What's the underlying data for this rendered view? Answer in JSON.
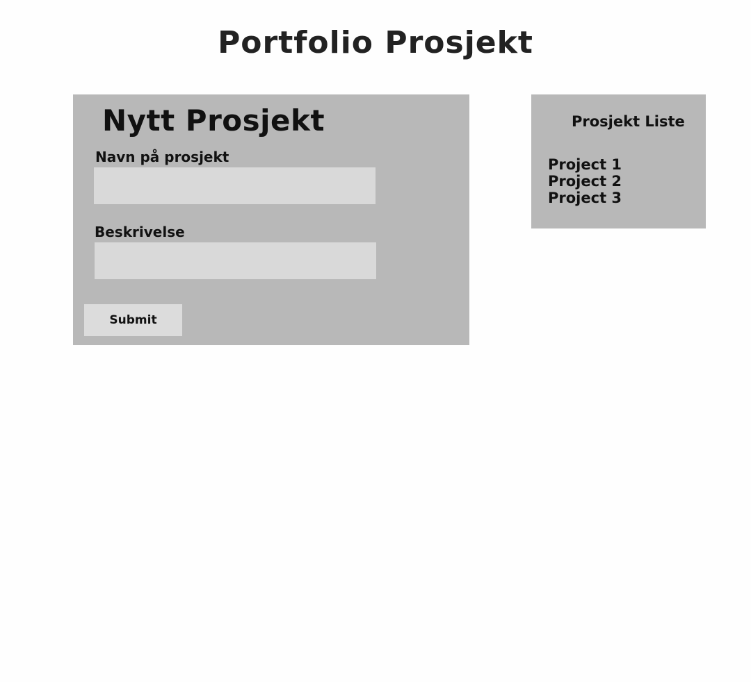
{
  "header": {
    "title": "Portfolio Prosjekt"
  },
  "form": {
    "heading": "Nytt Prosjekt",
    "name_label": "Navn på prosjekt",
    "name_value": "",
    "description_label": "Beskrivelse",
    "description_value": "",
    "submit_label": "Submit"
  },
  "project_list": {
    "heading": "Prosjekt Liste",
    "items": [
      {
        "label": "Project 1"
      },
      {
        "label": "Project 2"
      },
      {
        "label": "Project 3"
      }
    ]
  },
  "colors": {
    "panel_background": "#b8b8b8",
    "input_background": "#d9d9d9",
    "page_background": "#fefefe",
    "text": "#111111"
  }
}
